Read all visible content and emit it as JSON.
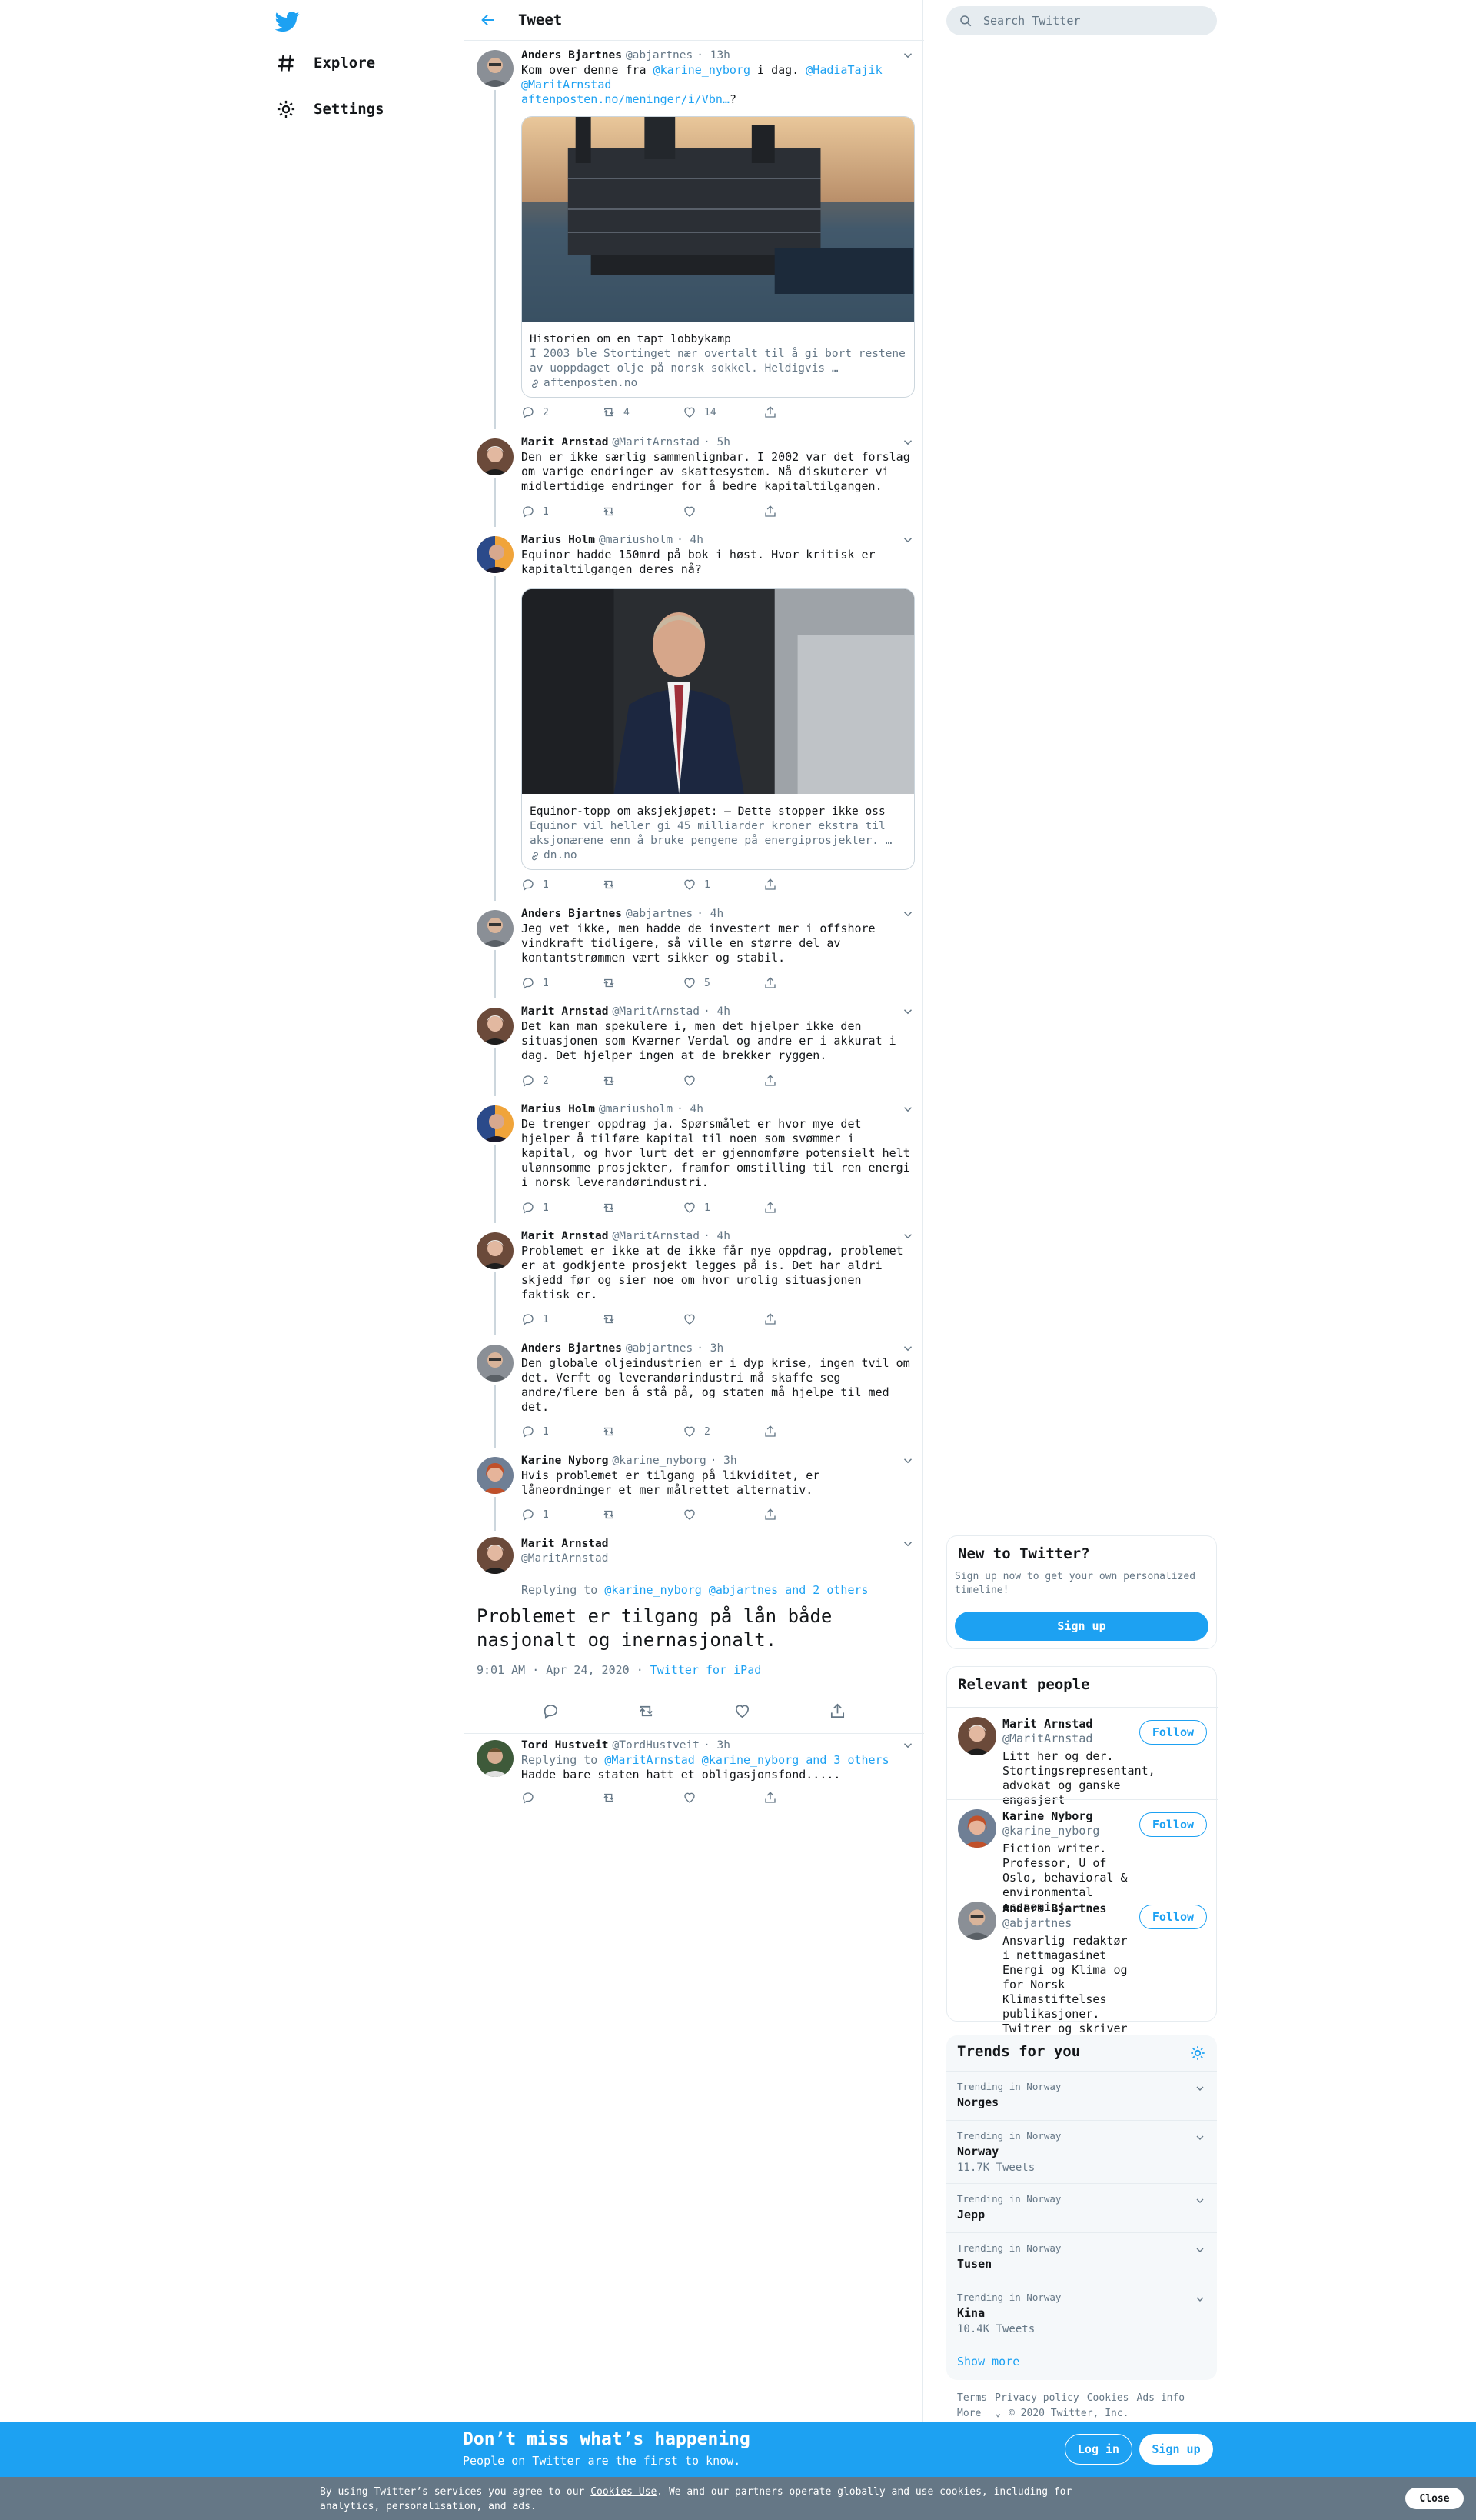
{
  "nav": {
    "explore_label": "Explore",
    "settings_label": "Settings"
  },
  "header": {
    "title": "Tweet"
  },
  "search": {
    "placeholder": "Search Twitter"
  },
  "tweets": [
    {
      "name": "Anders Bjartnes",
      "handle": "@abjartnes",
      "time": "· 13h",
      "text_plain": "Kom over denne fra ",
      "mention1": "@karine_nyborg",
      "text_mid": " i dag. ",
      "mention2": "@HadiaTajik",
      "mention3": "@MaritArnstad",
      "link": "aftenposten.no/meninger/i/Vbn…",
      "link_tail": "?",
      "card": {
        "title": "Historien om en tapt lobbykamp",
        "desc": "I 2003 ble Stortinget nær overtalt til å gi bort restene av uoppdaget olje på norsk sokkel. Heldigvis …",
        "domain": "aftenposten.no"
      },
      "replies": "2",
      "retweets": "4",
      "likes": "14"
    },
    {
      "name": "Marit Arnstad",
      "handle": "@MaritArnstad",
      "time": "· 5h",
      "text": "Den er ikke særlig sammenlignbar. I 2002 var det forslag om varige endringer av skattesystem. Nå diskuterer vi midlertidige endringer for å bedre kapitaltilgangen.",
      "replies": "1",
      "retweets": "",
      "likes": ""
    },
    {
      "name": "Marius Holm",
      "handle": "@mariusholm",
      "time": "· 4h",
      "text": "Equinor hadde 150mrd på bok i høst. Hvor kritisk er kapitaltilgangen deres nå?",
      "card": {
        "title": "Equinor-topp om aksjekjøpet: – Dette stopper ikke oss",
        "desc": "Equinor vil heller gi 45 milliarder kroner ekstra til aksjonærene enn å bruke pengene på energiprosjekter. …",
        "domain": "dn.no"
      },
      "replies": "1",
      "retweets": "",
      "likes": "1"
    },
    {
      "name": "Anders Bjartnes",
      "handle": "@abjartnes",
      "time": "· 4h",
      "text": "Jeg vet ikke, men hadde de investert mer i offshore vindkraft tidligere, så ville en større del av kontantstrømmen vært sikker og stabil.",
      "replies": "1",
      "retweets": "",
      "likes": "5"
    },
    {
      "name": "Marit Arnstad",
      "handle": "@MaritArnstad",
      "time": "· 4h",
      "text": "Det kan man spekulere i, men det hjelper ikke den situasjonen som Kværner Verdal og andre er i akkurat i dag. Det hjelper ingen at de brekker ryggen.",
      "replies": "2",
      "retweets": "",
      "likes": ""
    },
    {
      "name": "Marius Holm",
      "handle": "@mariusholm",
      "time": "· 4h",
      "text": "De trenger oppdrag ja. Spørsmålet er hvor mye det hjelper å tilføre kapital til noen som svømmer i kapital, og hvor lurt det er gjennomføre potensielt helt ulønnsomme prosjekter, framfor omstilling til ren energi i norsk leverandørindustri.",
      "replies": "1",
      "retweets": "",
      "likes": "1"
    },
    {
      "name": "Marit Arnstad",
      "handle": "@MaritArnstad",
      "time": "· 4h",
      "text": "Problemet er ikke at de ikke får nye oppdrag, problemet er at godkjente prosjekt legges på is. Det har aldri skjedd før og sier noe om hvor urolig situasjonen faktisk er.",
      "replies": "1",
      "retweets": "",
      "likes": ""
    },
    {
      "name": "Anders Bjartnes",
      "handle": "@abjartnes",
      "time": "· 3h",
      "text": "Den globale oljeindustrien er i dyp krise, ingen tvil om det. Verft og leverandørindustri må skaffe seg andre/flere ben å stå på, og staten må hjelpe til med det.",
      "replies": "1",
      "retweets": "",
      "likes": "2"
    },
    {
      "name": "Karine Nyborg",
      "handle": "@karine_nyborg",
      "time": "· 3h",
      "text": "Hvis problemet er tilgang på likviditet, er låneordninger et mer målrettet alternativ.",
      "replies": "1",
      "retweets": "",
      "likes": ""
    }
  ],
  "main_tweet": {
    "name": "Marit Arnstad",
    "handle": "@MaritArnstad",
    "replying_to_label": "Replying to ",
    "replying_to": "@karine_nyborg @abjartnes and 2 others",
    "text": "Problemet er tilgang på lån både nasjonalt og inernasjonalt.",
    "timestamp": "9:01 AM · Apr 24, 2020 · ",
    "source": "Twitter for iPad"
  },
  "reply_tweet": {
    "name": "Tord Hustveit",
    "handle": "@TordHustveit",
    "time": "· 3h",
    "replying_to_label": "Replying to ",
    "replying_to": "@MaritArnstad @karine_nyborg and 3 others",
    "text": "Hadde bare staten hatt et obligasjonsfond....."
  },
  "new_to_twitter": {
    "title": "New to Twitter?",
    "subtitle": "Sign up now to get your own personalized timeline!",
    "signup_label": "Sign up"
  },
  "relevant_people": {
    "title": "Relevant people",
    "follow_label": "Follow",
    "people": [
      {
        "name": "Marit Arnstad",
        "handle": "@MaritArnstad",
        "bio": "Litt her og der. Stortingsrepresentant, advokat og ganske engasjert"
      },
      {
        "name": "Karine Nyborg",
        "handle": "@karine_nyborg",
        "bio": "Fiction writer. Professor, U of Oslo, behavioral & environmental economics."
      },
      {
        "name": "Anders Bjartnes",
        "handle": "@abjartnes",
        "bio": "Ansvarlig redaktør i nettmagasinet Energi og Klima og for Norsk Klimastiftelses publikasjoner. Twitrer og skriver om klima og energi."
      }
    ]
  },
  "trends": {
    "title": "Trends for you",
    "items": [
      {
        "label": "Trending in Norway",
        "name": "Norges",
        "count": ""
      },
      {
        "label": "Trending in Norway",
        "name": "Norway",
        "count": "11.7K Tweets"
      },
      {
        "label": "Trending in Norway",
        "name": "Jepp",
        "count": ""
      },
      {
        "label": "Trending in Norway",
        "name": "Tusen",
        "count": ""
      },
      {
        "label": "Trending in Norway",
        "name": "Kina",
        "count": "10.4K Tweets"
      }
    ],
    "show_more": "Show more"
  },
  "footer": {
    "terms": "Terms",
    "privacy": "Privacy policy",
    "cookies": "Cookies",
    "ads": "Ads info",
    "more": "More",
    "copyright": "© 2020 Twitter, Inc."
  },
  "promo": {
    "title": "Don’t miss what’s happening",
    "subtitle": "People on Twitter are the first to know.",
    "login_label": "Log in",
    "signup_label": "Sign up"
  },
  "cookie_bar": {
    "text_before": "By using Twitter’s services you agree to our ",
    "link": "Cookies Use",
    "text_after": ". We and our partners operate globally and use cookies, including for analytics, personalisation, and ads.",
    "close_label": "Close"
  },
  "colors": {
    "accent": "#1da1f2",
    "text": "#14171a",
    "muted": "#657786",
    "border": "#e6ecf0"
  }
}
